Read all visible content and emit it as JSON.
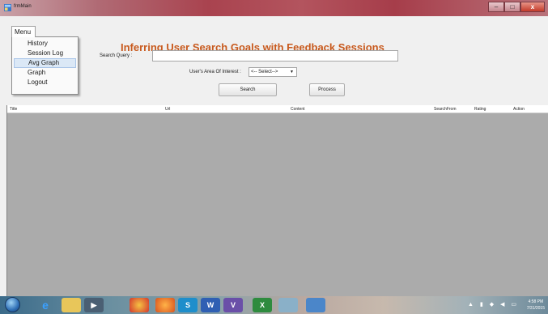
{
  "window": {
    "title": "frmMain",
    "controls": {
      "minimize": "–",
      "maximize": "□",
      "close": "x"
    }
  },
  "menu": {
    "root_label": "Menu",
    "items": [
      {
        "label": "History"
      },
      {
        "label": "Session Log"
      },
      {
        "label": "Avg Graph",
        "highlighted": true
      },
      {
        "label": "Graph"
      },
      {
        "label": "Logout"
      }
    ]
  },
  "app_title": "Inferring User Search Goals with Feedback Sessions",
  "search": {
    "label": "Search Query :",
    "value": ""
  },
  "area_of_interest": {
    "label": "User's Area Of Interest :",
    "selected": "<-- Select-->"
  },
  "buttons": {
    "search": "Search",
    "process": "Process"
  },
  "grid": {
    "columns": [
      "Title",
      "Url",
      "Content",
      "SearchFrom",
      "Rating",
      "Action"
    ]
  },
  "taskbar": {
    "clock_time": "4:58 PM",
    "clock_date": "7/31/2015"
  },
  "colors": {
    "title_accent": "#c85a1e",
    "grid_background": "#ababab",
    "menu_highlight": "#dbe8f6"
  }
}
